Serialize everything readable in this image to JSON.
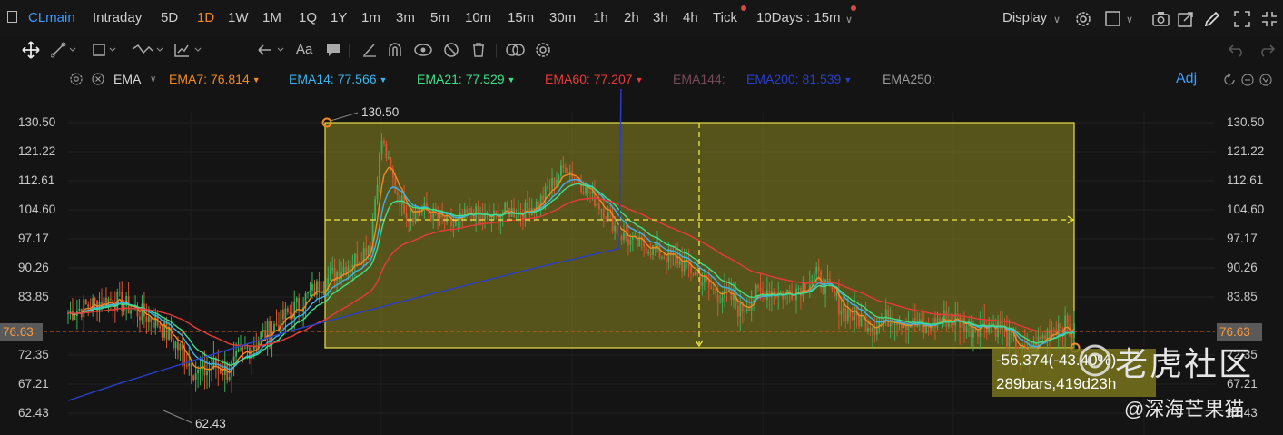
{
  "topbar": {
    "symbol": "CLmain",
    "periods": [
      {
        "label": "Intraday",
        "active": false
      },
      {
        "label": "5D",
        "active": false
      },
      {
        "label": "1D",
        "active": true
      },
      {
        "label": "1W",
        "active": false
      },
      {
        "label": "1M",
        "active": false
      },
      {
        "label": "1Q",
        "active": false
      },
      {
        "label": "1Y",
        "active": false
      },
      {
        "label": "1m",
        "active": false
      },
      {
        "label": "3m",
        "active": false
      },
      {
        "label": "5m",
        "active": false
      },
      {
        "label": "10m",
        "active": false
      },
      {
        "label": "15m",
        "active": false
      },
      {
        "label": "30m",
        "active": false
      },
      {
        "label": "1h",
        "active": false
      },
      {
        "label": "2h",
        "active": false
      },
      {
        "label": "3h",
        "active": false
      },
      {
        "label": "4h",
        "active": false
      },
      {
        "label": "Tick",
        "active": false
      }
    ],
    "range_select": "10Days : 15m",
    "display_label": "Display",
    "icons": [
      "settings-icon",
      "checkbox-icon",
      "camera-icon",
      "share-icon",
      "draw-icon",
      "fullscreen-icon"
    ]
  },
  "drawing_toolbar": {
    "icons": [
      "move-icon",
      "line-icon",
      "rectangle-icon",
      "pattern-icon",
      "measure-icon",
      "arrow-icon",
      "text-icon",
      "comment-icon",
      "ruler-icon",
      "magnet-icon",
      "eye-link-icon",
      "hide-icon",
      "delete-icon",
      "link-icon",
      "settings-icon",
      "undo-icon"
    ],
    "text_label": "Aa"
  },
  "indicator": {
    "name": "EMA",
    "adj_label": "Adj",
    "items": [
      {
        "label": "EMA7:",
        "value": "76.814",
        "color": "#f08a24",
        "arrow": true
      },
      {
        "label": "EMA14:",
        "value": "77.566",
        "color": "#3ab4ec",
        "arrow": true
      },
      {
        "label": "EMA21:",
        "value": "77.529",
        "color": "#3ee08a",
        "arrow": true
      },
      {
        "label": "EMA60:",
        "value": "77.207",
        "color": "#e83a3a",
        "arrow": true
      },
      {
        "label": "EMA144:",
        "value": "",
        "color": "#7a4a5c",
        "arrow": false
      },
      {
        "label": "EMA200:",
        "value": "81.539",
        "color": "#2a3fc8",
        "arrow": true
      },
      {
        "label": "EMA250:",
        "value": "",
        "color": "#9a9a9a",
        "arrow": false
      }
    ]
  },
  "chart_data": {
    "type": "candlestick",
    "symbol": "CLmain",
    "interval": "15m",
    "y_ticks": [
      130.5,
      121.22,
      112.61,
      104.6,
      97.17,
      90.26,
      83.85,
      76.63,
      72.35,
      67.21,
      62.43
    ],
    "current_price": 76.63,
    "high_marker": 130.5,
    "low_marker": 62.43,
    "price_path": [
      [
        0,
        80.5
      ],
      [
        10,
        82.2
      ],
      [
        20,
        83.5
      ],
      [
        30,
        81.0
      ],
      [
        40,
        78.5
      ],
      [
        50,
        73.2
      ],
      [
        58,
        69.0
      ],
      [
        66,
        70.5
      ],
      [
        72,
        69.5
      ],
      [
        80,
        73.5
      ],
      [
        90,
        77.0
      ],
      [
        100,
        81.0
      ],
      [
        110,
        85.5
      ],
      [
        120,
        89.5
      ],
      [
        130,
        93.0
      ],
      [
        135,
        96.5
      ],
      [
        140,
        125.0
      ],
      [
        142,
        120.0
      ],
      [
        146,
        110.5
      ],
      [
        152,
        103.0
      ],
      [
        158,
        105.0
      ],
      [
        165,
        102.5
      ],
      [
        172,
        100.5
      ],
      [
        180,
        104.0
      ],
      [
        188,
        102.0
      ],
      [
        195,
        104.5
      ],
      [
        202,
        104.0
      ],
      [
        210,
        106.5
      ],
      [
        215,
        111.0
      ],
      [
        222,
        117.0
      ],
      [
        228,
        112.5
      ],
      [
        234,
        108.0
      ],
      [
        240,
        104.0
      ],
      [
        246,
        98.5
      ],
      [
        252,
        96.0
      ],
      [
        258,
        95.5
      ],
      [
        265,
        93.5
      ],
      [
        272,
        92.0
      ],
      [
        280,
        89.0
      ],
      [
        288,
        85.0
      ],
      [
        296,
        83.5
      ],
      [
        300,
        81.0
      ],
      [
        306,
        84.0
      ],
      [
        312,
        85.5
      ],
      [
        320,
        84.5
      ],
      [
        328,
        86.5
      ],
      [
        334,
        88.5
      ],
      [
        340,
        85.0
      ],
      [
        346,
        81.0
      ],
      [
        352,
        79.5
      ],
      [
        360,
        78.0
      ],
      [
        368,
        80.0
      ],
      [
        375,
        78.5
      ],
      [
        382,
        77.0
      ],
      [
        390,
        79.5
      ],
      [
        397,
        79.0
      ],
      [
        403,
        77.5
      ],
      [
        410,
        78.5
      ],
      [
        416,
        77.5
      ],
      [
        422,
        74.0
      ],
      [
        428,
        71.5
      ],
      [
        434,
        75.0
      ],
      [
        438,
        77.0
      ],
      [
        443,
        78.5
      ],
      [
        449,
        76.3
      ]
    ],
    "ema_lines": [
      {
        "name": "EMA7",
        "color": "#f08a24"
      },
      {
        "name": "EMA14",
        "color": "#3ab4ec"
      },
      {
        "name": "EMA21",
        "color": "#3ee08a"
      },
      {
        "name": "EMA60",
        "color": "#e83a3a"
      },
      {
        "name": "EMA200",
        "color": "#2a3fc8"
      }
    ],
    "measure_box": {
      "from_price": 130.5,
      "to_price": 74.13,
      "change": "-56.374(-43.40%)",
      "span": "289bars,419d23h"
    }
  },
  "watermark": {
    "brand": "老虎社区",
    "author": "@深海芒果猫"
  }
}
